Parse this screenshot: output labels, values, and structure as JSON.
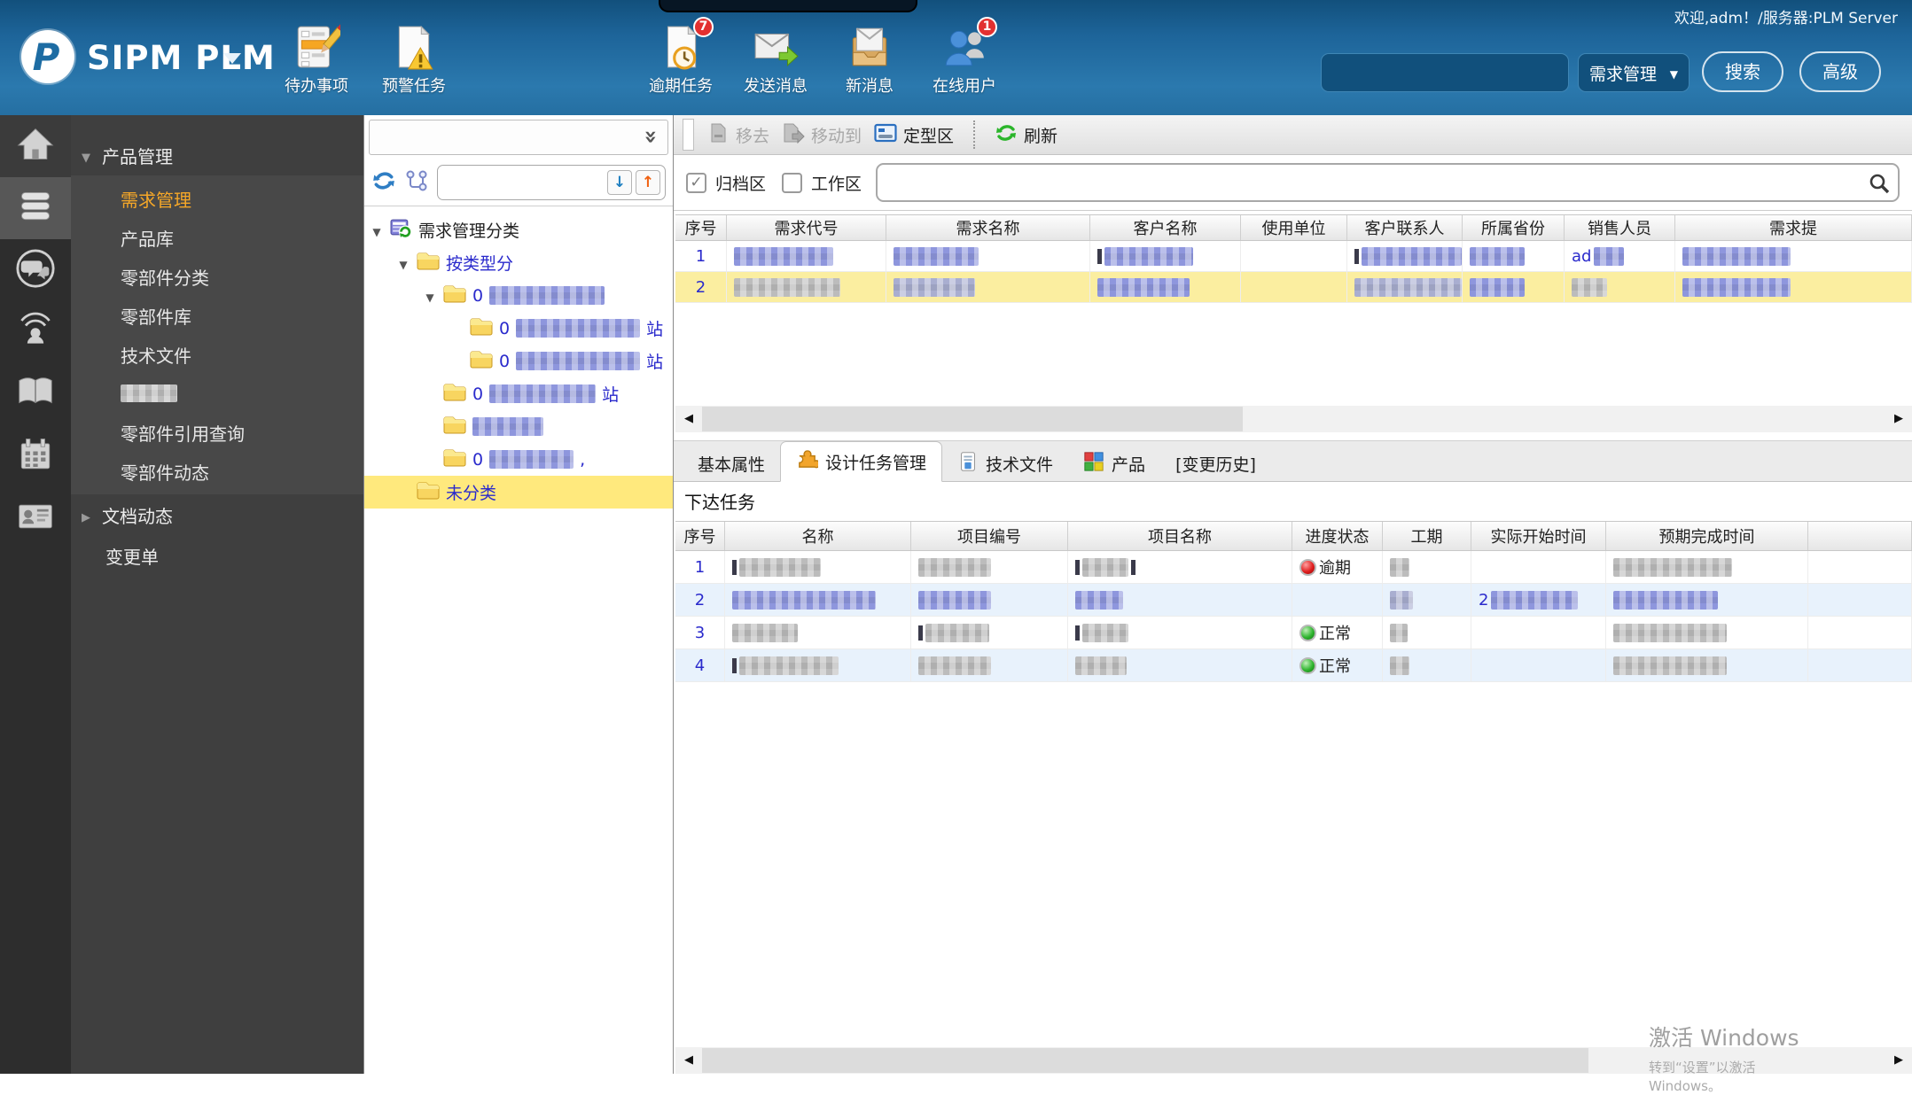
{
  "page": {
    "welcome": "欢迎,adm！/服务器:PLM Server",
    "brand": "SIPM PLM"
  },
  "colors": {
    "header_blue_top": "#12507c",
    "header_blue_bottom": "#2b79ae",
    "accent_orange": "#f5a728",
    "selection_yellow": "#fbeea0",
    "row_alt_blue": "#e8f2fc",
    "link_blue": "#2a2acc",
    "status_red": "#e02020",
    "status_green": "#30b530",
    "badge_red": "#e23030"
  },
  "top_icons": [
    {
      "label": "待办事项",
      "icon": "todo-list-icon",
      "badge": ""
    },
    {
      "label": "预警任务",
      "icon": "warning-task-icon",
      "badge": ""
    },
    {
      "label": "逾期任务",
      "icon": "overdue-task-icon",
      "badge": "7"
    },
    {
      "label": "发送消息",
      "icon": "send-message-icon",
      "badge": ""
    },
    {
      "label": "新消息",
      "icon": "new-message-icon",
      "badge": ""
    },
    {
      "label": "在线用户",
      "icon": "online-users-icon",
      "badge": "1"
    }
  ],
  "top_search": {
    "value": "",
    "scope": "需求管理",
    "search": "搜索",
    "advanced": "高级"
  },
  "side_icons": [
    "home-icon",
    "database-icon",
    "chat-icon",
    "broadcast-icon",
    "book-icon",
    "calendar-icon",
    "id-card-icon"
  ],
  "nav": {
    "group1": "产品管理",
    "items": [
      "需求管理",
      "产品库",
      "零部件分类",
      "零部件库",
      "技术文件",
      "",
      "零部件引用查询",
      "零部件动态"
    ],
    "selected": "需求管理",
    "group2": "文档动态",
    "item_last": "变更单"
  },
  "tree": {
    "root": "需求管理分类",
    "branch": "按类型分",
    "prefix": "0",
    "suffix": "站",
    "comma": ",",
    "unclassified": "未分类"
  },
  "content_toolbar": {
    "remove": "移去",
    "move_to": "移动到",
    "finalize": "定型区",
    "refresh": "刷新"
  },
  "filter": {
    "archive": "归档区",
    "workspace": "工作区",
    "search_value": ""
  },
  "upper_table": {
    "headers": [
      "序号",
      "需求代号",
      "需求名称",
      "客户名称",
      "使用单位",
      "客户联系人",
      "所属省份",
      "销售人员",
      "需求提"
    ],
    "rows": [
      {
        "no": "1",
        "sales_prefix": "ad"
      },
      {
        "no": "2"
      }
    ]
  },
  "tabs": [
    {
      "label": "基本属性"
    },
    {
      "label": "设计任务管理",
      "active": true,
      "icon": "puzzle-icon"
    },
    {
      "label": "技术文件",
      "icon": "document-icon"
    },
    {
      "label": "产品",
      "icon": "product-grid-icon"
    },
    {
      "label": "[变更历史]"
    }
  ],
  "section_label": "下达任务",
  "lower_table": {
    "headers": [
      "序号",
      "名称",
      "项目编号",
      "项目名称",
      "进度状态",
      "工期",
      "实际开始时间",
      "预期完成时间"
    ],
    "rows": [
      {
        "no": "1",
        "status": "逾期"
      },
      {
        "no": "2",
        "start_prefix": "2"
      },
      {
        "no": "3",
        "status": "正常"
      },
      {
        "no": "4",
        "status": "正常"
      }
    ]
  },
  "watermark": {
    "line1": "激活 Windows",
    "line2": "转到“设置”以激活 Windows。"
  }
}
